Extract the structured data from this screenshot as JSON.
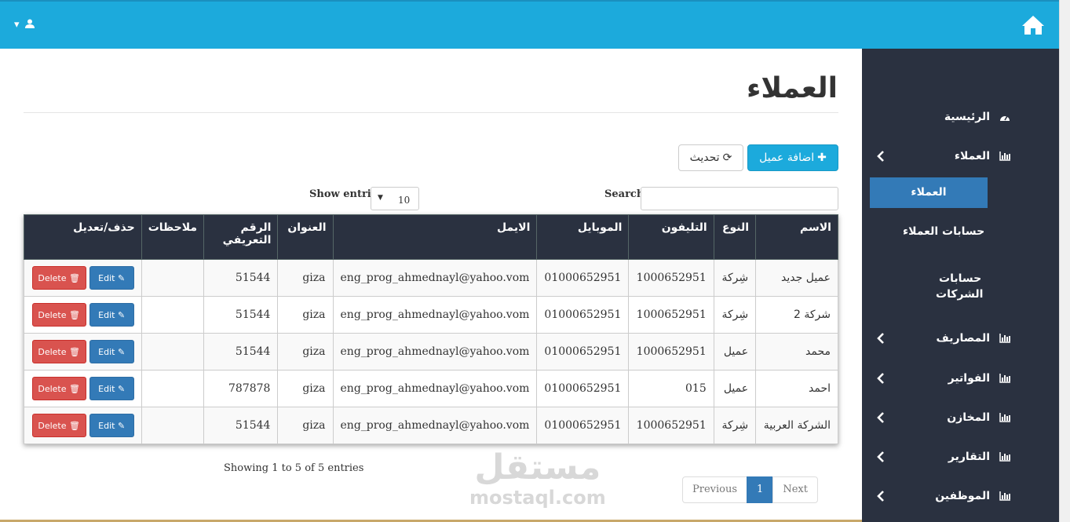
{
  "colors": {
    "topbar": "#1caadc",
    "sidebar": "#2a3140",
    "primary": "#337ab7",
    "danger": "#d9534f"
  },
  "sidebar": {
    "items": [
      {
        "label": "الرئيسية",
        "icon": "dashboard-icon",
        "expandable": false
      },
      {
        "label": "العملاء",
        "icon": "bar-chart-icon",
        "expandable": true
      },
      {
        "label": "المصاريف",
        "icon": "bar-chart-icon",
        "expandable": true
      },
      {
        "label": "الفواتير",
        "icon": "bar-chart-icon",
        "expandable": true
      },
      {
        "label": "المخازن",
        "icon": "bar-chart-icon",
        "expandable": true
      },
      {
        "label": "التقارير",
        "icon": "bar-chart-icon",
        "expandable": true
      },
      {
        "label": "الموظفين",
        "icon": "bar-chart-icon",
        "expandable": true
      }
    ],
    "subitems": [
      "العملاء",
      "حسابات العملاء",
      "حسابات",
      "الشركات"
    ]
  },
  "page": {
    "title": "العملاء",
    "add_button": "اضافة عميل",
    "refresh_button": "تحديث",
    "search_label": "Search:",
    "show_label": "Show entries",
    "show_value": "10",
    "info": "Showing 1 to 5 of 5 entries"
  },
  "table": {
    "headers": [
      "الاسم",
      "النوع",
      "التليفون",
      "الموبايل",
      "الايمل",
      "العنوان",
      "الرقم",
      "التعريفي",
      "ملاحظات",
      "حذف/تعديل"
    ],
    "rows": [
      [
        "عميل جديد",
        "شِركة",
        "1000652951",
        "01000652951",
        "eng_prog_ahmednayl@yahoo.vom",
        "giza",
        "51544",
        ""
      ],
      [
        "شركة 2",
        "شِركة",
        "1000652951",
        "01000652951",
        "eng_prog_ahmednayl@yahoo.vom",
        "giza",
        "51544",
        ""
      ],
      [
        "محمد",
        "عميل",
        "1000652951",
        "01000652951",
        "eng_prog_ahmednayl@yahoo.vom",
        "giza",
        "51544",
        ""
      ],
      [
        "احمد",
        "عميل",
        "015",
        "01000652951",
        "eng_prog_ahmednayl@yahoo.vom",
        "giza",
        "787878",
        ""
      ],
      [
        "الشركة العربية",
        "شِركة",
        "1000652951",
        "01000652951",
        "eng_prog_ahmednayl@yahoo.vom",
        "giza",
        "51544",
        ""
      ]
    ],
    "edit_label": "Edit",
    "delete_label": "Delete"
  },
  "pagination": {
    "previous": "Previous",
    "current": "1",
    "next": "Next"
  },
  "watermark": {
    "arabic": "مستقل",
    "latin": "mostaql.com"
  }
}
